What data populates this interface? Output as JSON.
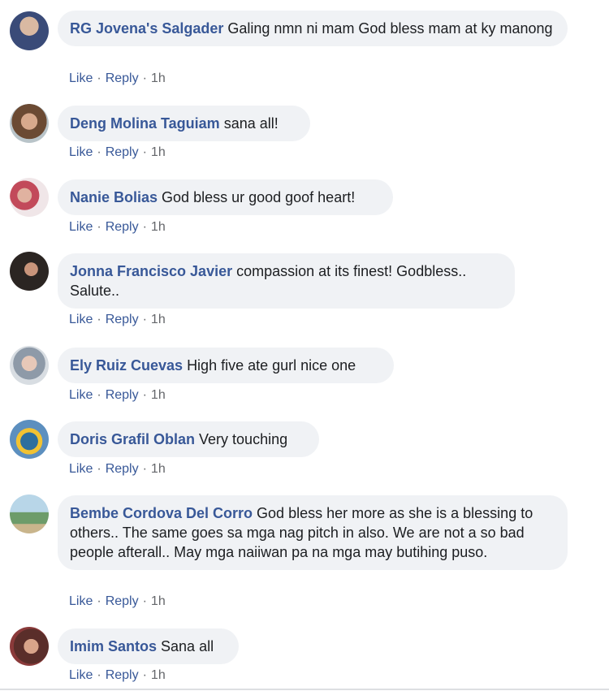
{
  "actions": {
    "like": "Like",
    "reply": "Reply",
    "separator": "·"
  },
  "comments": [
    {
      "author": "RG Jovena's Salgader",
      "text": "Galing nmn ni mam God bless mam at ky manong",
      "time": "1h"
    },
    {
      "author": "Deng Molina Taguiam",
      "text": "sana all!",
      "time": "1h"
    },
    {
      "author": "Nanie Bolias",
      "text": "God bless ur good goof heart!",
      "time": "1h"
    },
    {
      "author": "Jonna Francisco Javier",
      "text": "compassion at its finest! Godbless.. Salute..",
      "time": "1h"
    },
    {
      "author": "Ely Ruiz Cuevas",
      "text": "High five ate gurl nice one",
      "time": "1h"
    },
    {
      "author": "Doris Grafil Oblan",
      "text": "Very touching",
      "time": "1h"
    },
    {
      "author": "Bembe Cordova Del Corro",
      "text": "God bless her more as she is a blessing to others.. The same goes sa mga nag pitch in also. We are not a so bad people afterall.. May mga naiiwan pa na mga may butihing puso.",
      "time": "1h"
    },
    {
      "author": "Imim Santos",
      "text": "Sana all",
      "time": "1h"
    }
  ]
}
